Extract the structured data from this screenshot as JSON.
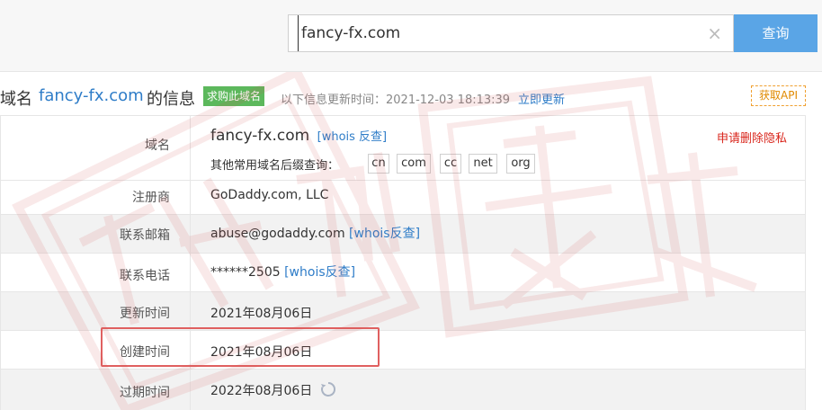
{
  "search": {
    "value": "fancy-fx.com",
    "clear_icon": "close-icon",
    "button_label": "查询"
  },
  "header": {
    "title_prefix": "域名",
    "title_domain": "fancy-fx.com",
    "title_suffix": "的信息",
    "buy_badge": "求购此域名",
    "update_label": "以下信息更新时间：2021-12-03 18:13:39",
    "update_link": "立即更新",
    "api_button": "获取API"
  },
  "rows": {
    "domain": {
      "label": "域名",
      "value": "fancy-fx.com",
      "whois_link": "[whois 反查]",
      "privacy_link": "申请删除隐私",
      "suffix_label": "其他常用域名后缀查询：",
      "suffixes": [
        "cn",
        "com",
        "cc",
        "net",
        "org"
      ]
    },
    "registrar": {
      "label": "注册商",
      "value": "GoDaddy.com, LLC"
    },
    "email": {
      "label": "联系邮箱",
      "value": "abuse@godaddy.com",
      "link": "[whois反查]"
    },
    "phone": {
      "label": "联系电话",
      "value": "******2505",
      "link": "[whois反查]"
    },
    "updated": {
      "label": "更新时间",
      "value": "2021年08月06日"
    },
    "created": {
      "label": "创建时间",
      "value": "2021年08月06日"
    },
    "expires": {
      "label": "过期时间",
      "value": "2022年08月06日",
      "icon": "refresh-icon"
    }
  },
  "colors": {
    "accent": "#2f7dc8",
    "search_button": "#5aa5e6",
    "badge": "#5cb85c",
    "highlight": "#e06060",
    "watermark": "#d25050"
  }
}
